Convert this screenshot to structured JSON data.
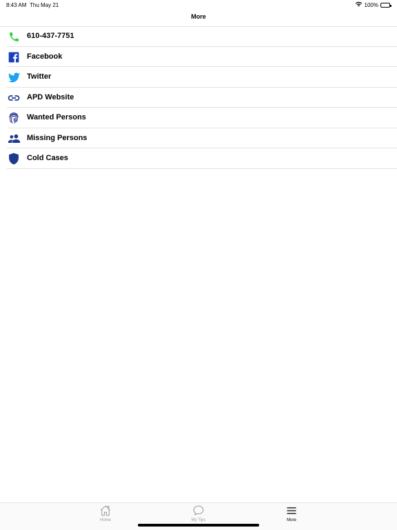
{
  "status_bar": {
    "time": "8:43 AM",
    "date": "Thu May 21",
    "battery_level": "100%",
    "icons": [
      "wifi-icon",
      "battery-icon"
    ]
  },
  "nav": {
    "title": "More"
  },
  "menu": {
    "items": [
      {
        "label": "610-437-7751",
        "icon": "phone-icon",
        "color": "#2ecc40"
      },
      {
        "label": "Facebook",
        "icon": "facebook-icon",
        "color": "#1877f2"
      },
      {
        "label": "Twitter",
        "icon": "twitter-icon",
        "color": "#1da1f2"
      },
      {
        "label": "APD Website",
        "icon": "link-icon",
        "color": "#1e3a8a"
      },
      {
        "label": "Wanted Persons",
        "icon": "fingerprint-icon",
        "color": "#2b3a8f"
      },
      {
        "label": "Missing Persons",
        "icon": "people-icon",
        "color": "#1e3a8a"
      },
      {
        "label": "Cold Cases",
        "icon": "shield-icon",
        "color": "#1e3a8a"
      }
    ]
  },
  "tab_bar": {
    "tabs": [
      {
        "label": "Home",
        "icon": "home-icon",
        "selected": false
      },
      {
        "label": "My Tips",
        "icon": "chat-bubble-icon",
        "selected": false
      },
      {
        "label": "More",
        "icon": "menu-icon",
        "selected": true
      }
    ]
  }
}
